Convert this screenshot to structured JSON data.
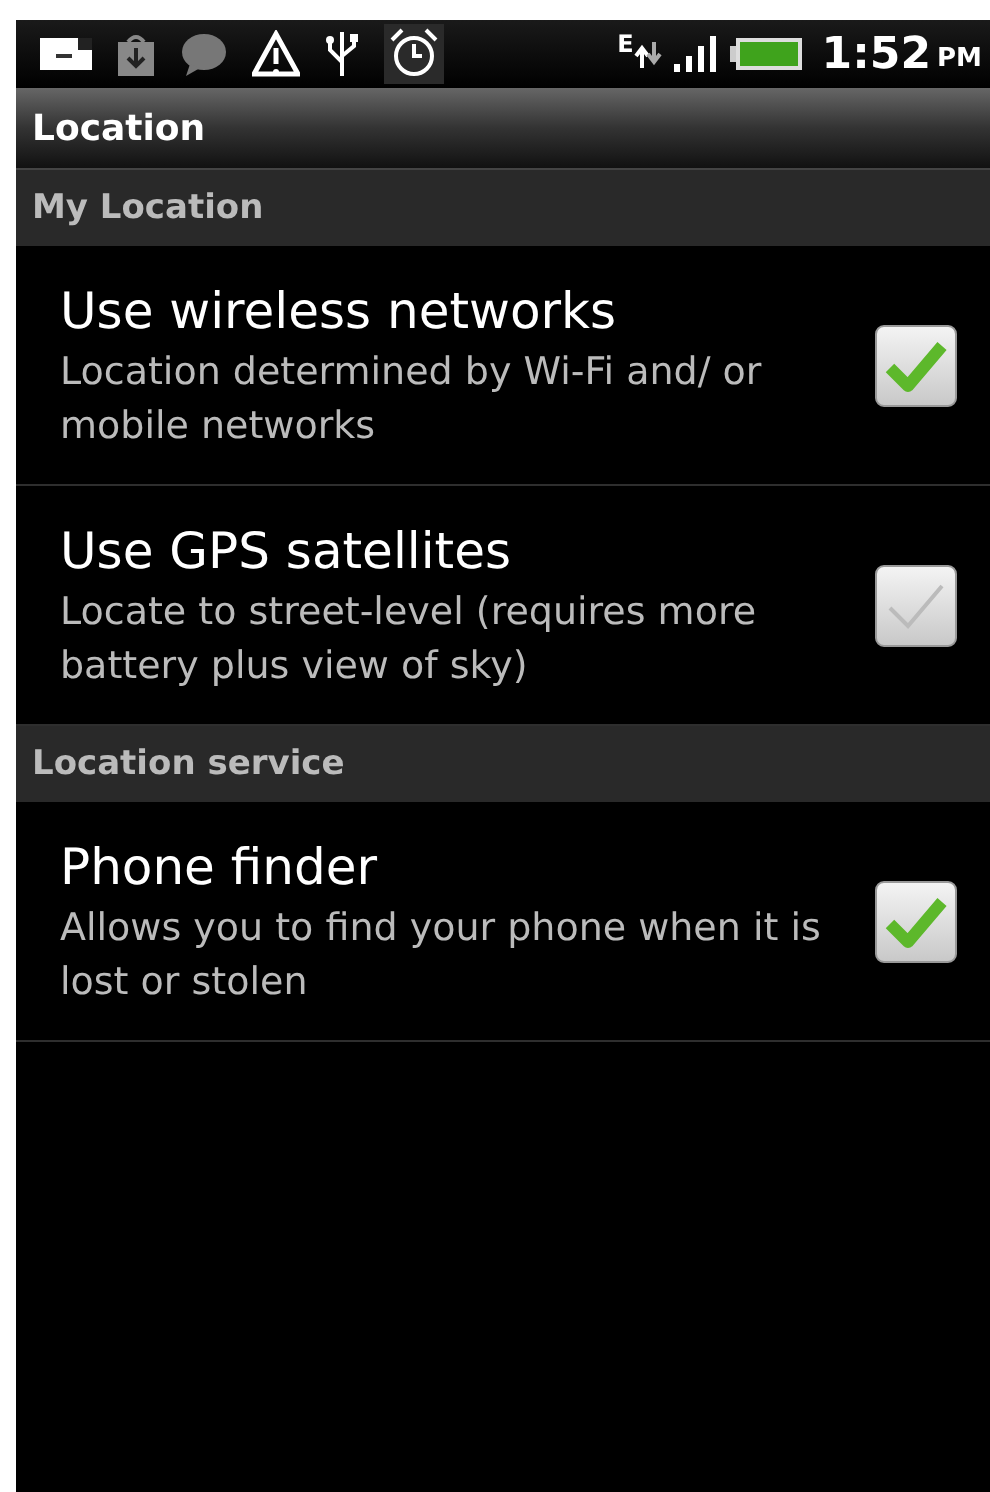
{
  "status_bar": {
    "network_type": "E",
    "time": "1:52",
    "meridiem": "PM"
  },
  "title": "Location",
  "sections": [
    {
      "header": "My Location",
      "items": [
        {
          "title": "Use wireless networks",
          "summary": "Location determined by Wi-Fi and/ or mobile networks",
          "checked": true
        },
        {
          "title": "Use GPS satellites",
          "summary": "Locate to street-level (requires more battery plus view of sky)",
          "checked": false
        }
      ]
    },
    {
      "header": "Location service",
      "items": [
        {
          "title": "Phone finder",
          "summary": "Allows you to find your phone when it is lost or stolen",
          "checked": true
        }
      ]
    }
  ]
}
